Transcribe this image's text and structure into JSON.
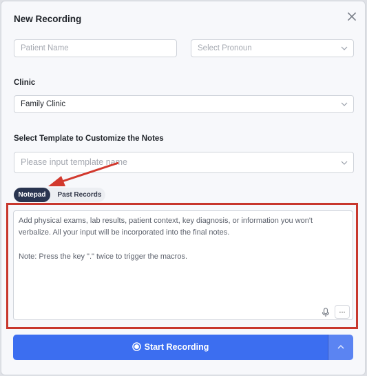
{
  "dialog": {
    "title": "New Recording"
  },
  "patient": {
    "name_placeholder": "Patient Name",
    "pronoun_placeholder": "Select Pronoun"
  },
  "clinic": {
    "label": "Clinic",
    "value": "Family Clinic"
  },
  "template": {
    "label": "Select Template to Customize the Notes",
    "placeholder": "Please input template name"
  },
  "tabs": [
    {
      "label": "Notepad",
      "active": true
    },
    {
      "label": "Past Records",
      "active": false
    }
  ],
  "notepad": {
    "lines": [
      "Add physical exams, lab results, patient context, key diagnosis, or information you won't",
      "verbalize. All your input will be incorporated into the final notes.",
      "Note: Press the key \".\" twice to trigger the macros."
    ],
    "more_label": "..."
  },
  "actions": {
    "start_label": "Start Recording"
  },
  "colors": {
    "primary": "#3c6ef0",
    "annotation": "#c8372d",
    "tab_active": "#2a3550"
  }
}
